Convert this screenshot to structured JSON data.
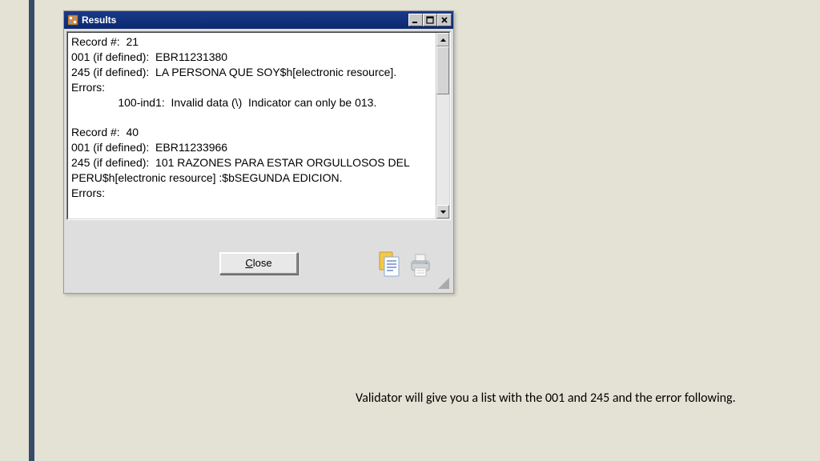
{
  "window": {
    "title": "Results",
    "close_label": "Close"
  },
  "results": {
    "lines": [
      "Record #:  21",
      "001 (if defined):  EBR11231380",
      "245 (if defined):  LA PERSONA QUE SOY$h[electronic resource].",
      "Errors:",
      "               100-ind1:  Invalid data (\\)  Indicator can only be 013.",
      "",
      "Record #:  40",
      "001 (if defined):  EBR11233966",
      "245 (if defined):  101 RAZONES PARA ESTAR ORGULLOSOS DEL PERU$h[electronic resource] :$bSEGUNDA EDICION.",
      "Errors:"
    ]
  },
  "caption": "Validator will give you a list with the 001 and 245 and the error following."
}
